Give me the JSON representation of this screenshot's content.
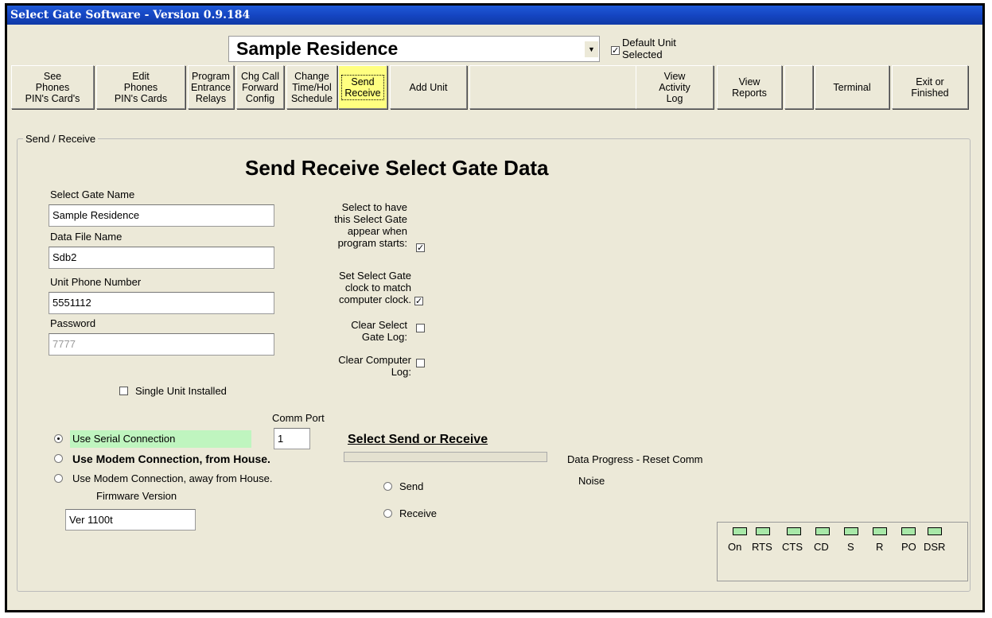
{
  "window": {
    "title": "Select Gate Software - Version 0.9.184"
  },
  "unit_selector": {
    "selected": "Sample Residence",
    "default_unit_label": "Default Unit\nSelected",
    "default_unit_checked": true
  },
  "toolbar": {
    "buttons": [
      {
        "label": "See\nPhones\nPIN's Card's"
      },
      {
        "label": "Edit\nPhones\nPIN's Cards"
      },
      {
        "label": "Program\nEntrance\nRelays"
      },
      {
        "label": "Chg Call\nForward\nConfig"
      },
      {
        "label": "Change\nTime/Hol\nSchedule"
      },
      {
        "label": "Send\nReceive"
      },
      {
        "label": "Add Unit"
      },
      {
        "label": ""
      },
      {
        "label": "View\nActivity\nLog"
      },
      {
        "label": "View\nReports"
      },
      {
        "label": ""
      },
      {
        "label": "Terminal"
      },
      {
        "label": "Exit or\nFinished"
      }
    ]
  },
  "panel": {
    "frame_title": "Send / Receive",
    "heading": "Send Receive  Select Gate Data",
    "fields": {
      "gate_name_label": "Select Gate Name",
      "gate_name": "Sample Residence",
      "data_file_label": "Data File Name",
      "data_file": "Sdb2",
      "phone_label": "Unit Phone Number",
      "phone": "5551112",
      "password_label": "Password",
      "password": "7777"
    },
    "options": {
      "appear_on_start": "Select to have\nthis Select Gate\nappear when\nprogram starts:",
      "sync_clock": "Set Select Gate\nclock to match\ncomputer clock.",
      "clear_gate_log": "Clear Select\nGate Log:",
      "clear_computer_log": "Clear Computer\nLog:"
    },
    "single_unit": "Single Unit Installed",
    "comm_port_label": "Comm Port",
    "comm_port": "1",
    "connection": {
      "serial": "Use Serial Connection",
      "modem_house": "Use Modem Connection, from House.",
      "modem_away": "Use Modem Connection, away from House."
    },
    "firmware_label": "Firmware Version",
    "firmware": "Ver 1100t",
    "send_receive_title": "Select Send or Receive",
    "send": "Send",
    "receive": "Receive",
    "progress_label": "Data Progress - Reset Comm",
    "noise_label": "Noise",
    "leds": [
      "On",
      "RTS",
      "CTS",
      "CD",
      "S",
      "R",
      "PO",
      "DSR"
    ]
  }
}
